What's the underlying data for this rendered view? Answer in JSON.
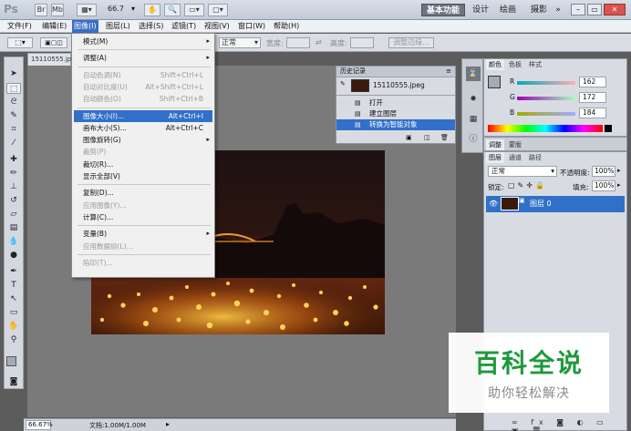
{
  "titlebar": {
    "logo": "Ps",
    "zoom": "66.7",
    "workspaces": [
      "基本功能",
      "设计",
      "绘画",
      "摄影"
    ],
    "more": "»"
  },
  "menubar": {
    "items": [
      "文件(F)",
      "编辑(E)",
      "图像(I)",
      "图层(L)",
      "选择(S)",
      "滤镜(T)",
      "视图(V)",
      "窗口(W)",
      "帮助(H)"
    ],
    "active_index": 2
  },
  "options": {
    "mode": "正常",
    "width_label": "宽度:",
    "height_label": "高度:",
    "adjust_edge": "调整边缘..."
  },
  "document": {
    "tab_title": "15110555.jp",
    "zoom_status": "66.67%",
    "doc_size": "文档:1.00M/1.00M"
  },
  "image_menu": {
    "items": [
      {
        "label": "模式(M)",
        "shortcut": "",
        "submenu": true,
        "disabled": false
      },
      {
        "sep": true
      },
      {
        "label": "调整(A)",
        "shortcut": "",
        "submenu": true,
        "disabled": false
      },
      {
        "sep": true
      },
      {
        "label": "自动色调(N)",
        "shortcut": "Shift+Ctrl+L",
        "submenu": false,
        "disabled": true
      },
      {
        "label": "自动对比度(U)",
        "shortcut": "Alt+Shift+Ctrl+L",
        "submenu": false,
        "disabled": true
      },
      {
        "label": "自动颜色(O)",
        "shortcut": "Shift+Ctrl+B",
        "submenu": false,
        "disabled": true
      },
      {
        "sep": true
      },
      {
        "label": "图像大小(I)...",
        "shortcut": "Alt+Ctrl+I",
        "submenu": false,
        "disabled": false,
        "highlight": true
      },
      {
        "label": "画布大小(S)...",
        "shortcut": "Alt+Ctrl+C",
        "submenu": false,
        "disabled": false
      },
      {
        "label": "图像旋转(G)",
        "shortcut": "",
        "submenu": true,
        "disabled": false
      },
      {
        "label": "裁剪(P)",
        "shortcut": "",
        "submenu": false,
        "disabled": true
      },
      {
        "label": "裁切(R)...",
        "shortcut": "",
        "submenu": false,
        "disabled": false
      },
      {
        "label": "显示全部(V)",
        "shortcut": "",
        "submenu": false,
        "disabled": false
      },
      {
        "sep": true
      },
      {
        "label": "复制(D)...",
        "shortcut": "",
        "submenu": false,
        "disabled": false
      },
      {
        "label": "应用图像(Y)...",
        "shortcut": "",
        "submenu": false,
        "disabled": true
      },
      {
        "label": "计算(C)...",
        "shortcut": "",
        "submenu": false,
        "disabled": false
      },
      {
        "sep": true
      },
      {
        "label": "变量(B)",
        "shortcut": "",
        "submenu": true,
        "disabled": false
      },
      {
        "label": "应用数据组(L)...",
        "shortcut": "",
        "submenu": false,
        "disabled": true
      },
      {
        "sep": true
      },
      {
        "label": "陷印(T)...",
        "shortcut": "",
        "submenu": false,
        "disabled": true
      }
    ]
  },
  "history": {
    "title": "历史记录",
    "snapshot": "15110555.jpeg",
    "states": [
      "打开",
      "建立图层",
      "转换为智能对象"
    ],
    "selected": 2
  },
  "color_panel": {
    "tabs": [
      "颜色",
      "色板",
      "样式"
    ],
    "channels": [
      {
        "label": "R",
        "value": "162"
      },
      {
        "label": "G",
        "value": "172"
      },
      {
        "label": "B",
        "value": "184"
      }
    ],
    "swatch": "#a2acb8"
  },
  "adjust_panel": {
    "tabs": [
      "调整",
      "蒙版"
    ]
  },
  "layers_panel": {
    "tabs": [
      "图层",
      "通道",
      "路径"
    ],
    "blend_mode": "正常",
    "opacity_label": "不透明度:",
    "opacity": "100%",
    "lock_label": "锁定:",
    "fill_label": "填充:",
    "fill": "100%",
    "layer_name": "图层 0"
  },
  "watermark": {
    "main": "百科全说",
    "sub": "助你轻松解决"
  },
  "colors": {
    "accent": "#3170c8",
    "watermark_green": "#1e9a3d"
  }
}
